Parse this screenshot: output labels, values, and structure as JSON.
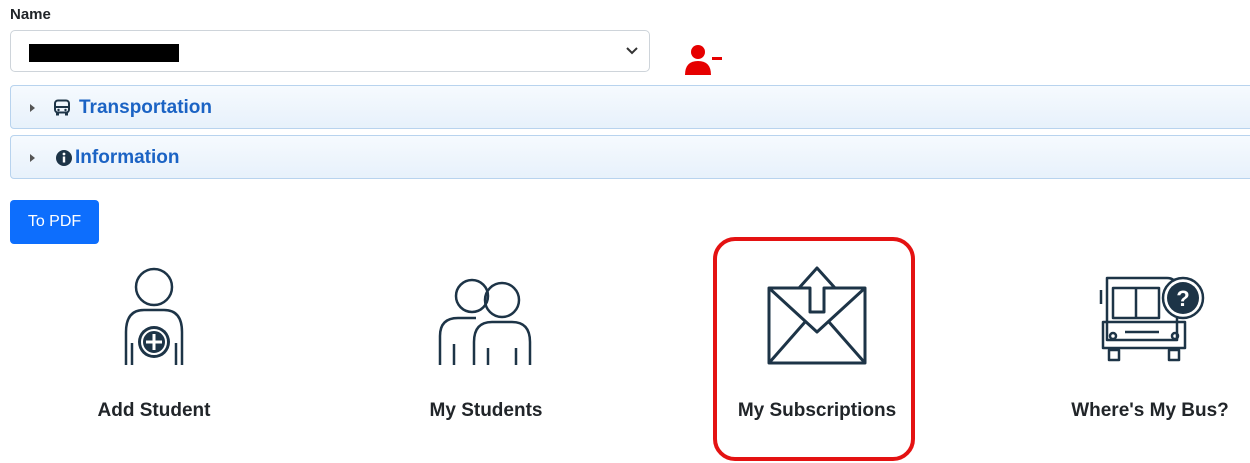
{
  "form": {
    "name_label": "Name"
  },
  "icons": {
    "select_chevron": "chevron-down-icon",
    "remove_user": "user-minus-icon",
    "transportation": "bus-icon",
    "information": "info-circle-icon",
    "add_student": "person-plus-icon",
    "my_students": "two-people-icon",
    "my_subscriptions": "envelope-upload-icon",
    "wheres_my_bus": "bus-question-icon"
  },
  "accordion": {
    "sections": [
      {
        "label": "Transportation"
      },
      {
        "label": "Information"
      }
    ]
  },
  "toolbar": {
    "pdf_label": "To PDF"
  },
  "tiles": [
    {
      "label": "Add Student"
    },
    {
      "label": "My Students"
    },
    {
      "label": "My Subscriptions"
    },
    {
      "label": "Where's My Bus?"
    }
  ],
  "colors": {
    "accent_blue": "#1b63c4",
    "button_blue": "#0d6efd",
    "highlight_red": "#e41212",
    "remove_red": "#e60000",
    "icon_navy": "#1d3447"
  }
}
